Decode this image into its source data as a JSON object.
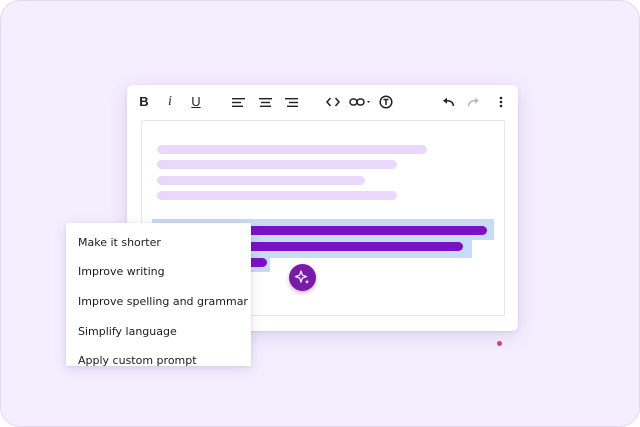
{
  "toolbar": {
    "bold_label": "B",
    "italic_label": "i",
    "underline_label": "U",
    "icons": {
      "align_left": "align-left-icon",
      "align_center": "align-center-icon",
      "align_right": "align-right-icon",
      "code": "code-icon",
      "link": "link-icon",
      "ai_tool": "ai-tool-icon",
      "undo": "undo-icon",
      "redo": "redo-icon",
      "more": "more-vertical-icon"
    }
  },
  "ai_button": {
    "icon": "sparkle-icon"
  },
  "ai_menu": {
    "items": [
      "Make it shorter",
      "Improve writing",
      "Improve spelling and grammar",
      "Simplify language",
      "Apply custom prompt"
    ]
  },
  "colors": {
    "background": "#f5eeff",
    "placeholder_text": "#e9d8fb",
    "selection": "#c7dbf6",
    "selected_text": "#7a12c4",
    "ai_button": "#7a1aa8",
    "accent_dot": "#e0348f"
  }
}
